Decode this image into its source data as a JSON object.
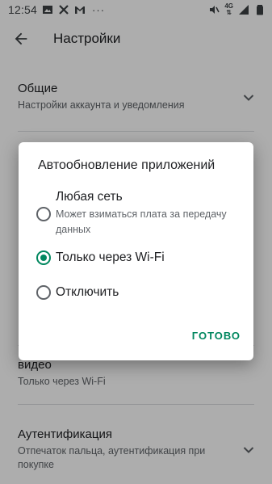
{
  "status_bar": {
    "time": "12:54",
    "left_icons": [
      "image-icon",
      "cross-icon",
      "gmail-icon"
    ],
    "more": "···",
    "network": "4G"
  },
  "app_bar": {
    "title": "Настройки"
  },
  "settings": {
    "general": {
      "title": "Общие",
      "subtitle": "Настройки аккаунта и уведомления"
    },
    "video": {
      "title": "видео",
      "subtitle": "Только через Wi-Fi"
    },
    "auth": {
      "title": "Аутентификация",
      "subtitle": "Отпечаток пальца, аутентификация при покупке"
    }
  },
  "dialog": {
    "title": "Автообновление приложений",
    "options": [
      {
        "label": "Любая сеть",
        "description": "Может взиматься плата за передачу данных",
        "checked": false
      },
      {
        "label": "Только через Wi-Fi",
        "description": "",
        "checked": true
      },
      {
        "label": "Отключить",
        "description": "",
        "checked": false
      }
    ],
    "done_label": "ГОТОВО"
  },
  "colors": {
    "accent": "#01875f",
    "scrim": "rgba(0,0,0,0.32)"
  }
}
